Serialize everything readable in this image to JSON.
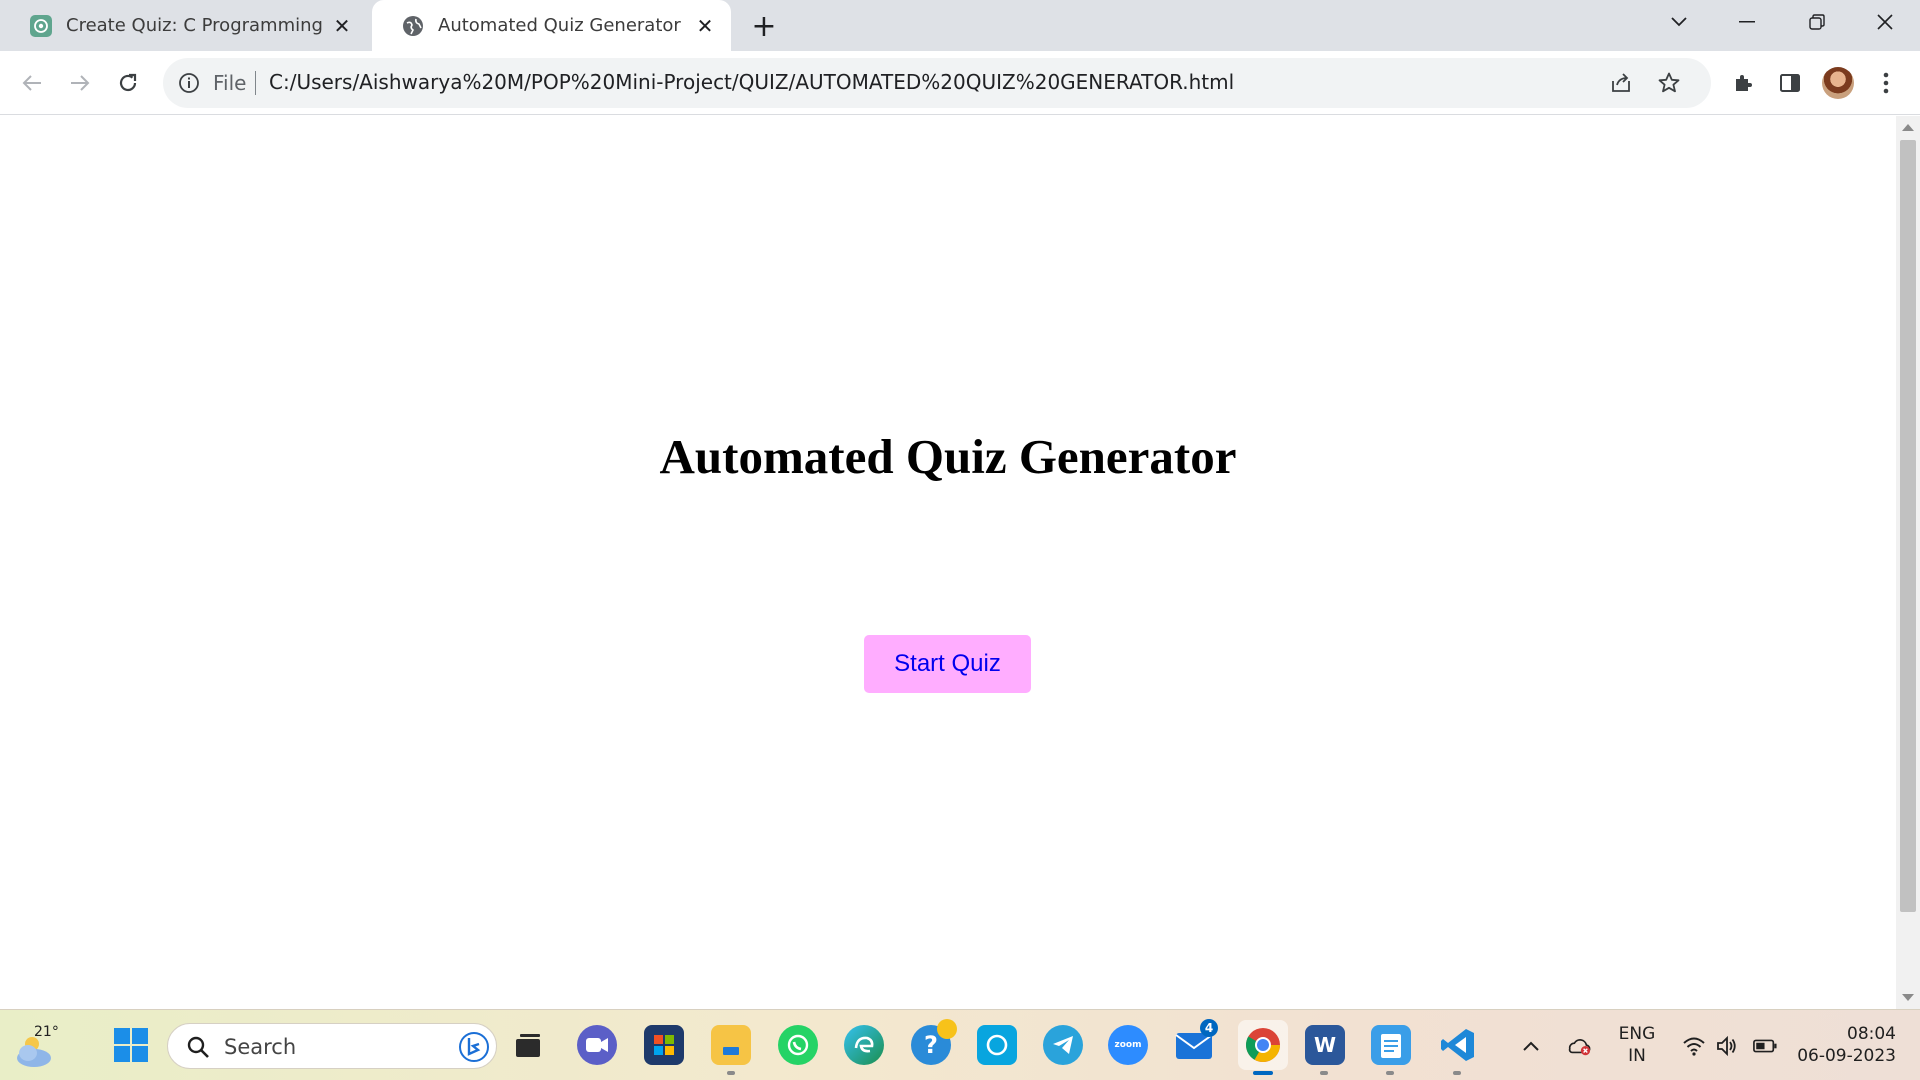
{
  "browser": {
    "tabs": [
      {
        "title": "Create Quiz: C Programming",
        "icon": "chatgpt-icon",
        "active": false
      },
      {
        "title": "Automated Quiz Generator",
        "icon": "globe-icon",
        "active": true
      }
    ],
    "omnibox": {
      "scheme_label": "File",
      "url": "C:/Users/Aishwarya%20M/POP%20Mini-Project/QUIZ/AUTOMATED%20QUIZ%20GENERATOR.html"
    }
  },
  "page": {
    "title": "Automated Quiz Generator",
    "start_button_label": "Start Quiz",
    "button_color": "#ffadff",
    "button_text_color": "#0000ee"
  },
  "taskbar": {
    "weather_temp": "21°",
    "search_placeholder": "Search",
    "mail_badge": "4",
    "apps": [
      "task-view",
      "teams-chat",
      "microsoft-store",
      "file-explorer",
      "whatsapp",
      "edge",
      "get-help",
      "alexa",
      "telegram",
      "zoom",
      "mail",
      "chrome",
      "word",
      "notepad",
      "vscode"
    ],
    "zoom_label": "zoom",
    "word_label": "W",
    "language": "ENG",
    "region": "IN",
    "time": "08:04",
    "date": "06-09-2023"
  }
}
